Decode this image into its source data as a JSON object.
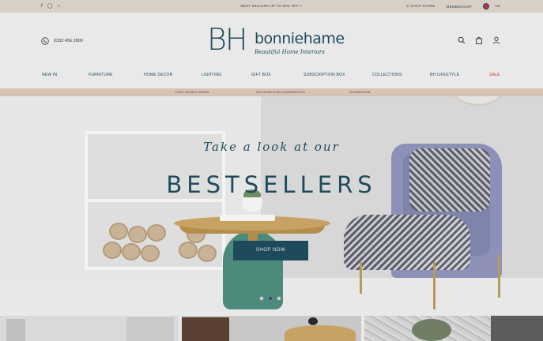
{
  "topbar": {
    "promo": "BEST SELLERS UP TO 50% OFF  >",
    "socials": [
      "facebook-icon",
      "instagram-icon",
      "tiktok-icon"
    ],
    "links": [
      "⊙ SHOP STORE",
      "MEMBERSHIP"
    ],
    "locale": "UK"
  },
  "header": {
    "phone": "0333 456 2800",
    "logo": {
      "mark": "BH",
      "name": "bonniehame",
      "tagline": "Beautiful Home Interiors"
    },
    "icons": [
      "search-icon",
      "bag-icon",
      "account-icon"
    ]
  },
  "nav": {
    "items": [
      "NEW IN",
      "FURNITURE",
      "HOME DECOR",
      "LIGHTING",
      "GIFT BOX",
      "SUBSCRIPTION BOX",
      "COLLECTIONS",
      "BH LIFESTYLE",
      "SALE"
    ]
  },
  "strip": {
    "items": [
      "FAST WORKS NOWS",
      "SATISFACTION GUARANTEED",
      "SHOWROOM"
    ]
  },
  "hero": {
    "script": "Take a look at our",
    "title": "BESTSELLERS",
    "button": "SHOP NOW",
    "slides": 3,
    "active_slide": 2
  },
  "colors": {
    "brand": "#1e4b5c",
    "topbar": "#d8cfc6",
    "strip": "#d8c2b3",
    "sale": "#c0392b"
  }
}
